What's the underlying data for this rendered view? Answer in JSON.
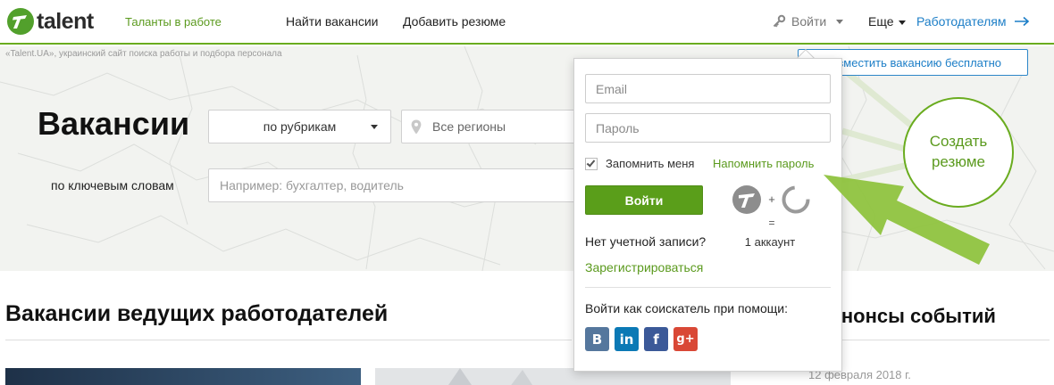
{
  "header": {
    "logo_text": "talent",
    "tagline": "Таланты в работе",
    "nav": [
      "Найти вакансии",
      "Добавить резюме"
    ],
    "login_label": "Войти",
    "more_label": "Еще",
    "employers_label": "Работодателям"
  },
  "hero": {
    "site_description": "«Talent.UA», украинский сайт поиска работы и подбора персонала",
    "title": "Вакансии",
    "rubric_select": "по рубрикам",
    "region_select": "Все регионы",
    "keywords_label": "по ключевым словам",
    "keywords_placeholder": "Например: бухгалтер, водитель",
    "post_vacancy_label": "Разместить вакансию бесплатно",
    "create_resume_lines": [
      "Создать",
      "резюме"
    ]
  },
  "login_panel": {
    "email_placeholder": "Email",
    "password_placeholder": "Пароль",
    "remember_label": "Запомнить меня",
    "remember_checked": true,
    "remind_label": "Напомнить пароль",
    "login_button": "Войти",
    "no_account": "Нет учетной записи?",
    "register_label": "Зарегистрироваться",
    "one_account_plus": "+",
    "one_account_eq": "=",
    "one_account_label": "1 аккаунт",
    "social_label": "Войти как соискатель при помощи:",
    "social": [
      {
        "id": "vk",
        "glyph": "B",
        "icon": "vk-icon"
      },
      {
        "id": "li",
        "glyph": "in",
        "icon": "linkedin-icon"
      },
      {
        "id": "fb",
        "glyph": "f",
        "icon": "facebook-icon"
      },
      {
        "id": "gp",
        "glyph": "g+",
        "icon": "google-plus-icon"
      }
    ]
  },
  "sections": {
    "top_employers": "Вакансии ведущих работодателей",
    "events": "Анонсы событий",
    "event_date": "12 февраля 2018 г."
  },
  "colors": {
    "brand_green": "#5a9e1a",
    "link_blue": "#1c7ec7",
    "arrow_green": "#8fc33f"
  }
}
